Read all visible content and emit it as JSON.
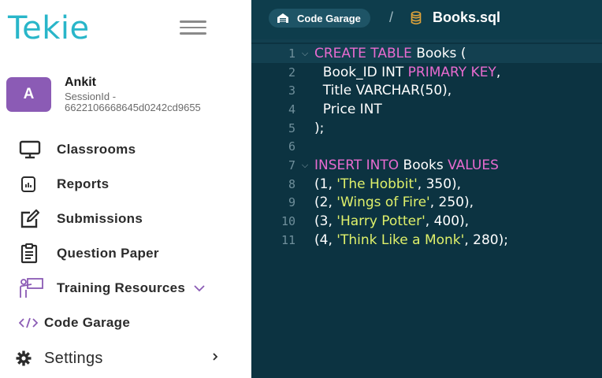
{
  "sidebar": {
    "logo": "Tekie",
    "user": {
      "initial": "A",
      "name": "Ankit",
      "session_label": "SessionId -",
      "session_id": "6622106668645d0242cd9655"
    },
    "nav": [
      {
        "label": "Classrooms",
        "icon": "monitor-icon"
      },
      {
        "label": "Reports",
        "icon": "report-icon"
      },
      {
        "label": "Submissions",
        "icon": "edit-icon"
      },
      {
        "label": "Question Paper",
        "icon": "clipboard-icon"
      },
      {
        "label": "Training Resources",
        "icon": "teacher-board-icon"
      }
    ],
    "code_garage": {
      "label": "Code Garage",
      "icon": "code-icon"
    },
    "settings": {
      "label": "Settings",
      "icon": "gear-icon"
    }
  },
  "editor": {
    "breadcrumb": {
      "section": "Code Garage",
      "separator": "/",
      "file": "Books.sql"
    },
    "lines": [
      {
        "n": "1",
        "fold": true,
        "tokens": [
          {
            "t": "CREATE TABLE",
            "k": "kw"
          },
          {
            "t": " Books ("
          }
        ]
      },
      {
        "n": "2",
        "fold": false,
        "tokens": [
          {
            "t": "  Book_ID INT "
          },
          {
            "t": "PRIMARY KEY",
            "k": "kw"
          },
          {
            "t": ","
          }
        ]
      },
      {
        "n": "3",
        "fold": false,
        "tokens": [
          {
            "t": "  Title VARCHAR(50),"
          }
        ]
      },
      {
        "n": "4",
        "fold": false,
        "tokens": [
          {
            "t": "  Price INT"
          }
        ]
      },
      {
        "n": "5",
        "fold": false,
        "tokens": [
          {
            "t": ");"
          }
        ]
      },
      {
        "n": "6",
        "fold": false,
        "tokens": []
      },
      {
        "n": "7",
        "fold": true,
        "tokens": [
          {
            "t": "INSERT INTO",
            "k": "kw"
          },
          {
            "t": " Books "
          },
          {
            "t": "VALUES",
            "k": "kw"
          }
        ]
      },
      {
        "n": "8",
        "fold": false,
        "tokens": [
          {
            "t": "(1, "
          },
          {
            "t": "'The Hobbit'",
            "k": "str"
          },
          {
            "t": ", 350),"
          }
        ]
      },
      {
        "n": "9",
        "fold": false,
        "tokens": [
          {
            "t": "(2, "
          },
          {
            "t": "'Wings of Fire'",
            "k": "str"
          },
          {
            "t": ", 250),"
          }
        ]
      },
      {
        "n": "10",
        "fold": false,
        "tokens": [
          {
            "t": "(3, "
          },
          {
            "t": "'Harry Potter'",
            "k": "str"
          },
          {
            "t": ", 400),"
          }
        ]
      },
      {
        "n": "11",
        "fold": false,
        "tokens": [
          {
            "t": "(4, "
          },
          {
            "t": "'Think Like a Monk'",
            "k": "str"
          },
          {
            "t": ", 280);"
          }
        ]
      }
    ]
  },
  "colors": {
    "brand": "#29b6c9",
    "avatar": "#8b5bb5",
    "editor_bg": "#0c3341",
    "keyword": "#e86bd0",
    "string": "#dff06a"
  }
}
